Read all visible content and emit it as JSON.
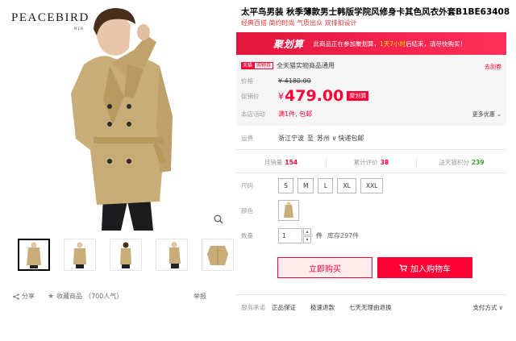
{
  "gallery": {
    "brand": "PEACEBIRD",
    "brand_sub": "MEN",
    "thumbnails": [
      "thumb-1",
      "thumb-2",
      "thumb-3",
      "thumb-4",
      "thumb-5"
    ],
    "share_label": "分享",
    "favorite_label": "收藏商品",
    "favorite_count": "（700人气）",
    "report_label": "举报"
  },
  "product": {
    "title": "太平鸟男装 秋季薄款男士韩版学院风修身卡其色风衣外套B1BE63408",
    "subtitle": "经典百搭 简约时尚 气质出众 双排扣设计"
  },
  "promo": {
    "jhs_logo": "聚划算",
    "jhs_text_prefix": "此商品正在参加聚划算，",
    "jhs_text_highlight": "1天7小时",
    "jhs_text_suffix": "后结束，请尽快购买！",
    "tmall_tag": "天猫",
    "tmall_tag2": "购物券",
    "coupon_text": "全天猫实物商品通用",
    "coupon_link": "去刮券",
    "price_label": "价格",
    "orig_price": "¥ 4180.00",
    "promo_label": "促销价",
    "currency": "¥",
    "promo_price": "479.00",
    "promo_tag": "聚划算",
    "activity_label": "本店活动",
    "activity_text": "满1件, 包邮",
    "more_offers": "更多优惠"
  },
  "shipping": {
    "label": "运费",
    "from": "浙江宁波",
    "to_prefix": "至",
    "to": "苏州",
    "type": "快递包邮"
  },
  "stats": {
    "sales_label": "月销量",
    "sales_value": "154",
    "reviews_label": "累计评价",
    "reviews_value": "38",
    "points_label": "送天猫积分",
    "points_value": "239"
  },
  "options": {
    "size_label": "尺码",
    "sizes": [
      "S",
      "M",
      "L",
      "XL",
      "XXL"
    ],
    "color_label": "颜色",
    "qty_label": "数量",
    "qty_value": "1",
    "qty_unit": "件",
    "stock": "库存297件"
  },
  "actions": {
    "buy_now": "立即购买",
    "add_to_cart": "加入购物车"
  },
  "service": {
    "label": "服务承诺",
    "items": [
      "正品保证",
      "极速退款",
      "七天无理由退换"
    ],
    "payment": "支付方式"
  },
  "colors": {
    "accent": "#ff0036",
    "jhs_red": "#e3153c",
    "coat": "#c9ad78",
    "green": "#3a9e2a"
  }
}
